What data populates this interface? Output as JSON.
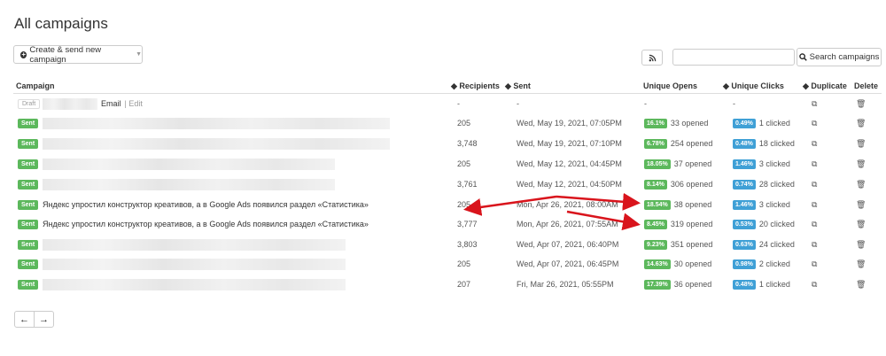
{
  "page": {
    "title": "All campaigns"
  },
  "toolbar": {
    "create_label": "Create & send new campaign",
    "search_placeholder": "",
    "search_label": "Search campaigns"
  },
  "table": {
    "headers": {
      "campaign": "Campaign",
      "recipients": "Recipients",
      "sent": "Sent",
      "opens": "Unique Opens",
      "clicks": "Unique Clicks",
      "duplicate": "Duplicate",
      "delete": "Delete"
    },
    "rows": [
      {
        "status": "Draft",
        "name": "Email",
        "edit": "| Edit",
        "recipients": "-",
        "sent": "-",
        "open_pct": "",
        "opened": "-",
        "click_pct": "",
        "clicked": "-"
      },
      {
        "status": "Sent",
        "name": "",
        "recipients": "205",
        "sent": "Wed, May 19, 2021, 07:05PM",
        "open_pct": "16.1%",
        "opened": "33 opened",
        "click_pct": "0.49%",
        "clicked": "1 clicked"
      },
      {
        "status": "Sent",
        "name": "",
        "recipients": "3,748",
        "sent": "Wed, May 19, 2021, 07:10PM",
        "open_pct": "6.78%",
        "opened": "254 opened",
        "click_pct": "0.48%",
        "clicked": "18 clicked"
      },
      {
        "status": "Sent",
        "name": "",
        "recipients": "205",
        "sent": "Wed, May 12, 2021, 04:45PM",
        "open_pct": "18.05%",
        "opened": "37 opened",
        "click_pct": "1.46%",
        "clicked": "3 clicked"
      },
      {
        "status": "Sent",
        "name": "",
        "recipients": "3,761",
        "sent": "Wed, May 12, 2021, 04:50PM",
        "open_pct": "8.14%",
        "opened": "306 opened",
        "click_pct": "0.74%",
        "clicked": "28 clicked"
      },
      {
        "status": "Sent",
        "name": "Яндекс упростил конструктор креативов, а в Google Ads появился раздел «Статистика»",
        "recipients": "205",
        "sent": "Mon, Apr 26, 2021, 08:00AM",
        "open_pct": "18.54%",
        "opened": "38 opened",
        "click_pct": "1.46%",
        "clicked": "3 clicked"
      },
      {
        "status": "Sent",
        "name": "Яндекс упростил конструктор креативов, а в Google Ads появился раздел «Статистика»",
        "recipients": "3,777",
        "sent": "Mon, Apr 26, 2021, 07:55AM",
        "open_pct": "8.45%",
        "opened": "319 opened",
        "click_pct": "0.53%",
        "clicked": "20 clicked"
      },
      {
        "status": "Sent",
        "name": "",
        "recipients": "3,803",
        "sent": "Wed, Apr 07, 2021, 06:40PM",
        "open_pct": "9.23%",
        "opened": "351 opened",
        "click_pct": "0.63%",
        "clicked": "24 clicked"
      },
      {
        "status": "Sent",
        "name": "",
        "recipients": "205",
        "sent": "Wed, Apr 07, 2021, 06:45PM",
        "open_pct": "14.63%",
        "opened": "30 opened",
        "click_pct": "0.98%",
        "clicked": "2 clicked"
      },
      {
        "status": "Sent",
        "name": "",
        "recipients": "207",
        "sent": "Fri, Mar 26, 2021, 05:55PM",
        "open_pct": "17.39%",
        "opened": "36 opened",
        "click_pct": "0.48%",
        "clicked": "1 clicked"
      }
    ]
  },
  "pagination": {
    "prev": "←",
    "next": "→"
  },
  "colors": {
    "sent_badge": "#5cb85c",
    "open_badge": "#5cb85c",
    "click_badge": "#3fa0d6",
    "annotation_arrow": "#d9141c"
  }
}
